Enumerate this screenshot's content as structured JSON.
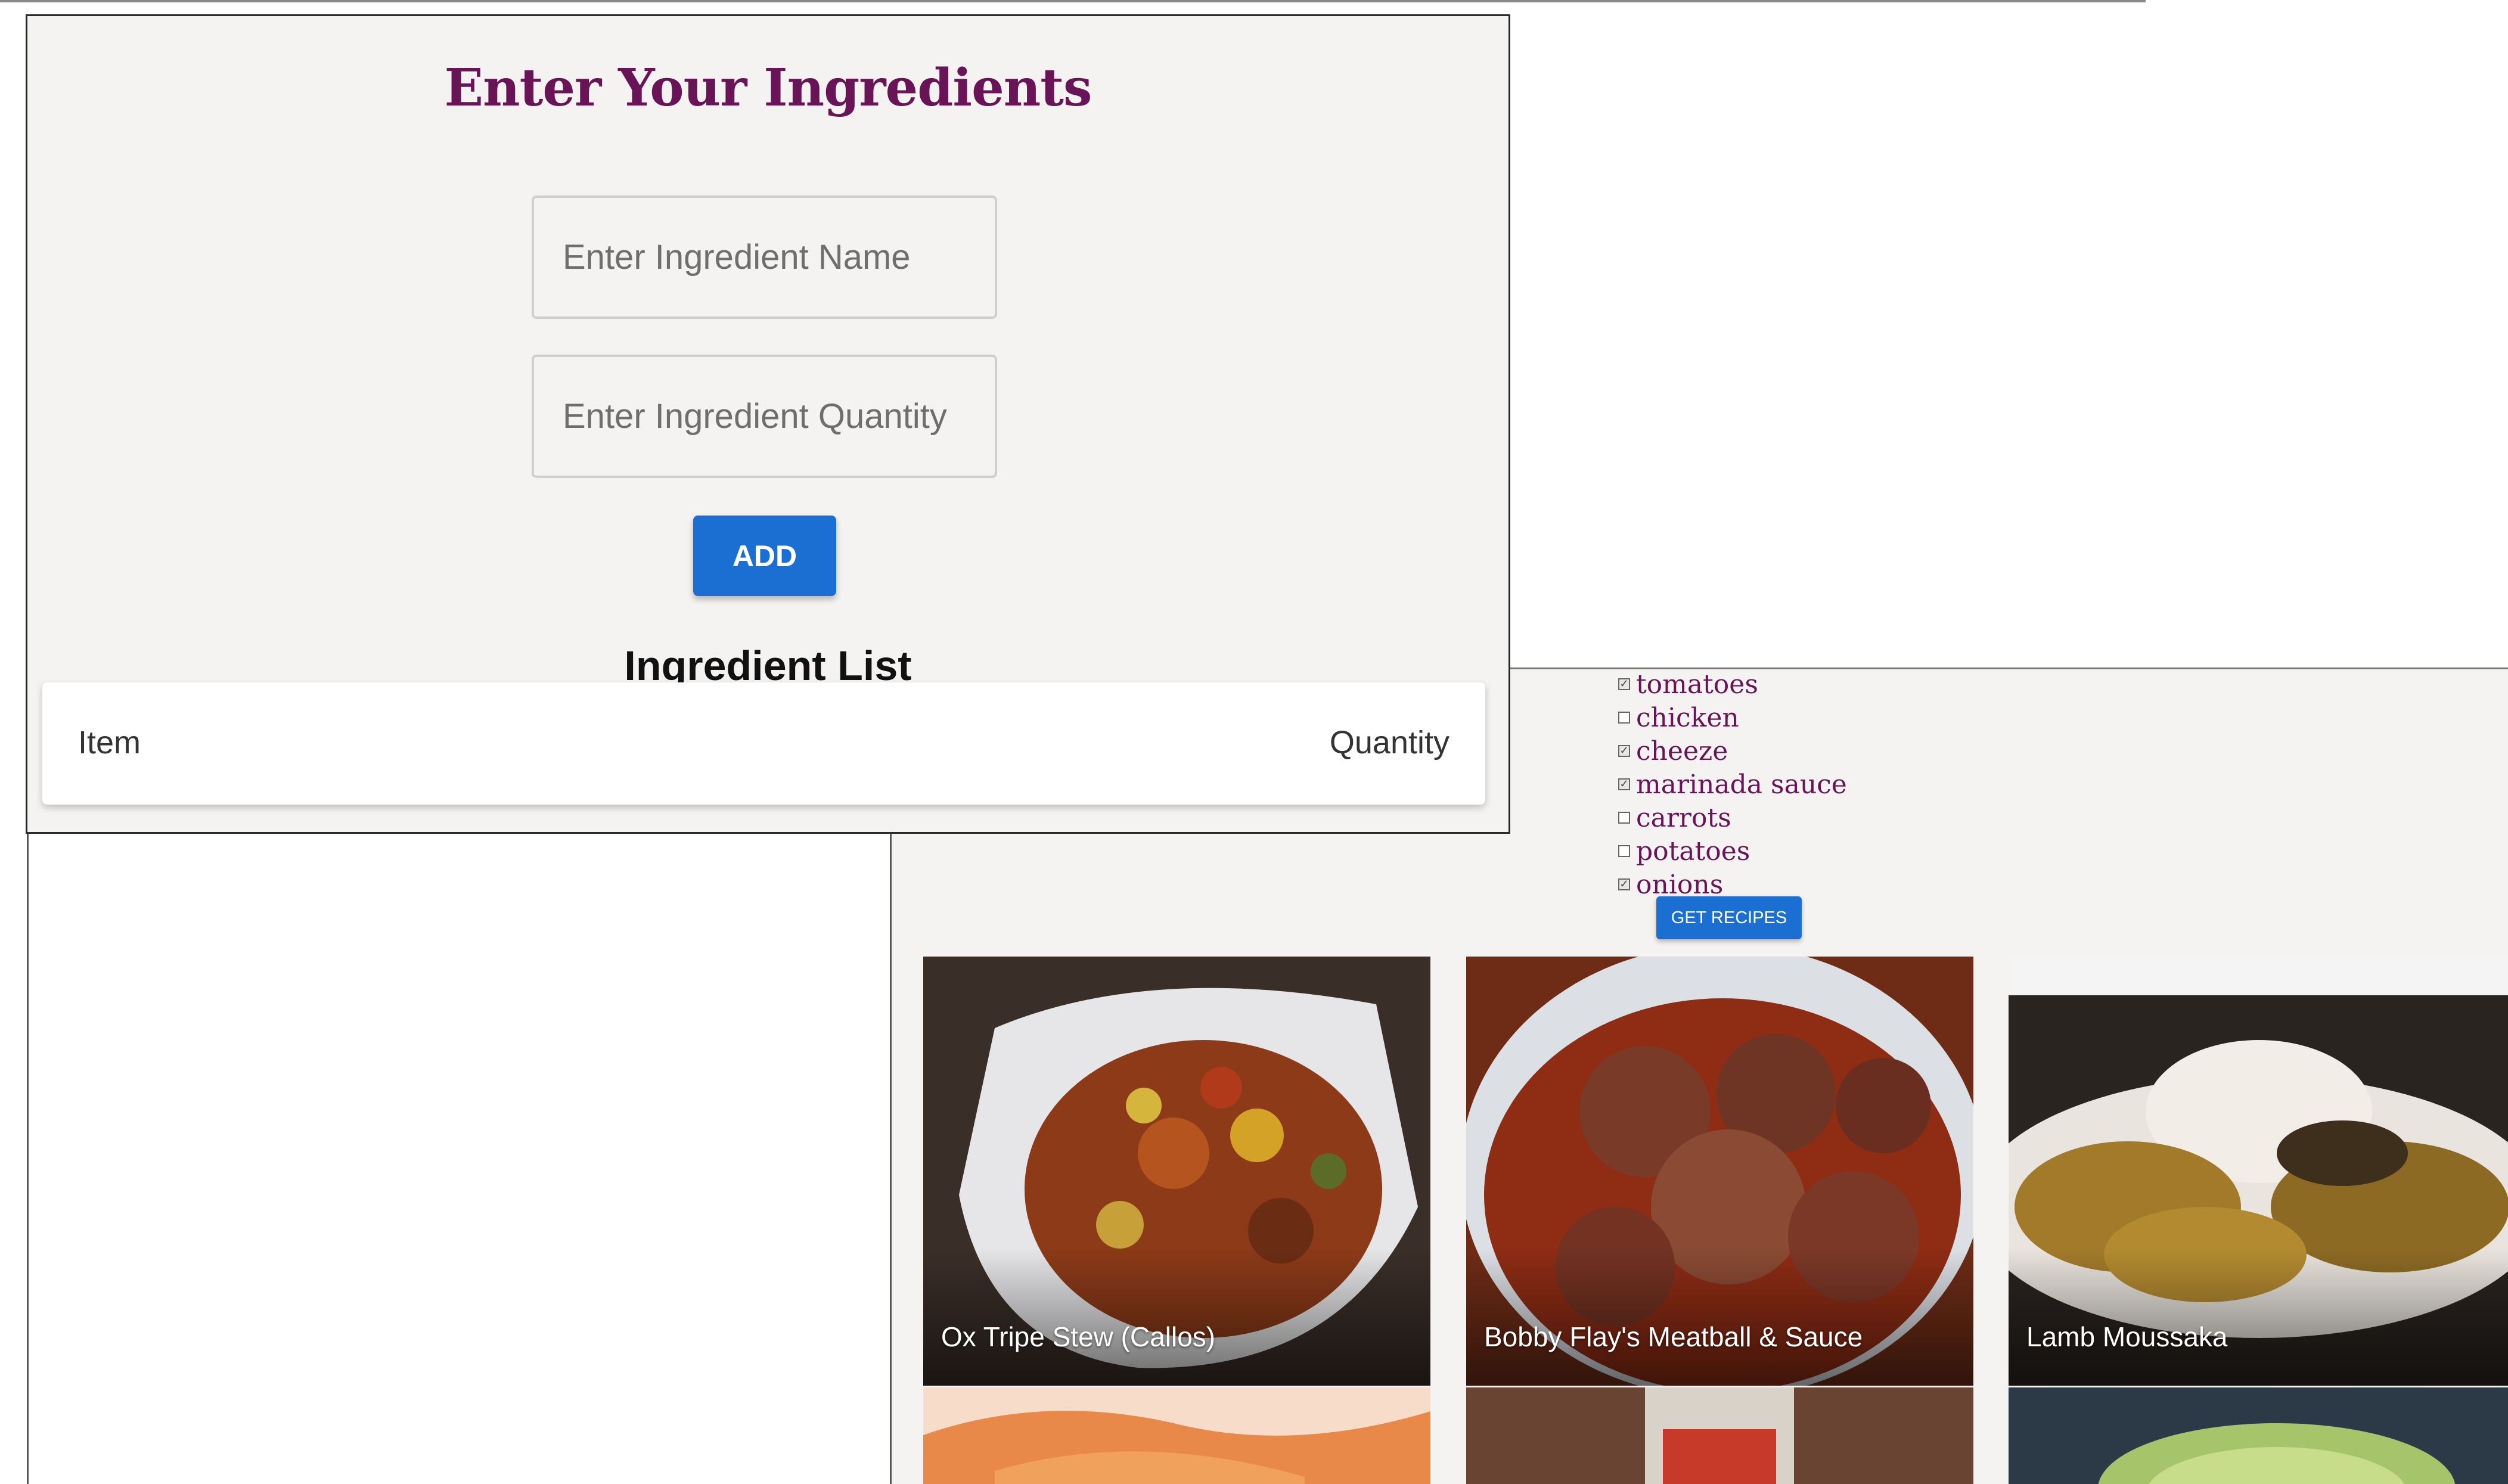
{
  "ingredient_form": {
    "title": "Enter Your Ingredients",
    "name_placeholder": "Enter Ingredient Name",
    "quantity_placeholder": "Enter Ingredient Quantity",
    "add_button": "ADD",
    "list_heading": "Ingredient List",
    "columns": [
      "Item",
      "Quantity"
    ]
  },
  "ingredients_checklist": [
    {
      "label": "tomatoes",
      "checked": true
    },
    {
      "label": "chicken",
      "checked": false
    },
    {
      "label": "cheeze",
      "checked": true
    },
    {
      "label": "marinada sauce",
      "checked": true
    },
    {
      "label": "carrots",
      "checked": false
    },
    {
      "label": "potatoes",
      "checked": false
    },
    {
      "label": "onions",
      "checked": true
    }
  ],
  "get_recipes_button": "GET RECIPES",
  "recipes": [
    {
      "title": "Ox Tripe Stew (Callos)",
      "image": "ox-tripe-stew-photo"
    },
    {
      "title": "Bobby Flay's Meatball & Sauce",
      "image": "meatball-sauce-photo"
    },
    {
      "title": "Lamb Moussaka",
      "image": "lamb-moussaka-photo"
    }
  ],
  "colors": {
    "accent": "#6a1458",
    "button": "#1b6fd3",
    "panel": "#f5f3f1"
  }
}
